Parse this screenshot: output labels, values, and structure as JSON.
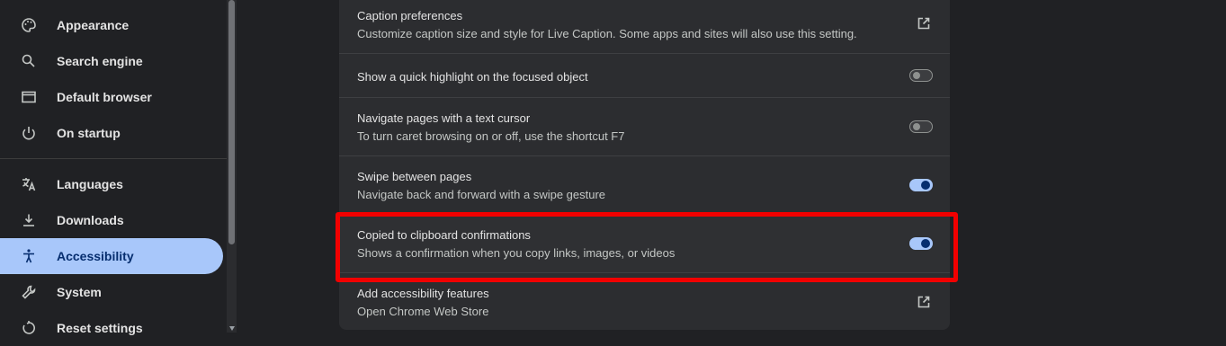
{
  "sidebar": {
    "items": [
      {
        "label": "Appearance",
        "icon": "palette-icon"
      },
      {
        "label": "Search engine",
        "icon": "search-icon"
      },
      {
        "label": "Default browser",
        "icon": "browser-window-icon"
      },
      {
        "label": "On startup",
        "icon": "power-icon"
      },
      {
        "label": "Languages",
        "icon": "translate-icon"
      },
      {
        "label": "Downloads",
        "icon": "download-icon"
      },
      {
        "label": "Accessibility",
        "icon": "accessibility-icon",
        "active": true
      },
      {
        "label": "System",
        "icon": "wrench-icon"
      },
      {
        "label": "Reset settings",
        "icon": "reset-icon"
      }
    ]
  },
  "settings": {
    "rows": [
      {
        "title": "Caption preferences",
        "subtitle": "Customize caption size and style for Live Caption. Some apps and sites will also use this setting.",
        "control": "external-link"
      },
      {
        "title": "Show a quick highlight on the focused object",
        "control": "toggle",
        "checked": false
      },
      {
        "title": "Navigate pages with a text cursor",
        "subtitle": "To turn caret browsing on or off, use the shortcut F7",
        "control": "toggle",
        "checked": false
      },
      {
        "title": "Swipe between pages",
        "subtitle": "Navigate back and forward with a swipe gesture",
        "control": "toggle",
        "checked": true
      },
      {
        "title": "Copied to clipboard confirmations",
        "subtitle": "Shows a confirmation when you copy links, images, or videos",
        "control": "toggle",
        "checked": true,
        "highlighted": true
      },
      {
        "title": "Add accessibility features",
        "subtitle": "Open Chrome Web Store",
        "control": "external-link"
      }
    ]
  },
  "colors": {
    "background": "#202124",
    "card": "#2c2d30",
    "accent": "#a8c7fa",
    "highlight_border": "#f20000"
  }
}
